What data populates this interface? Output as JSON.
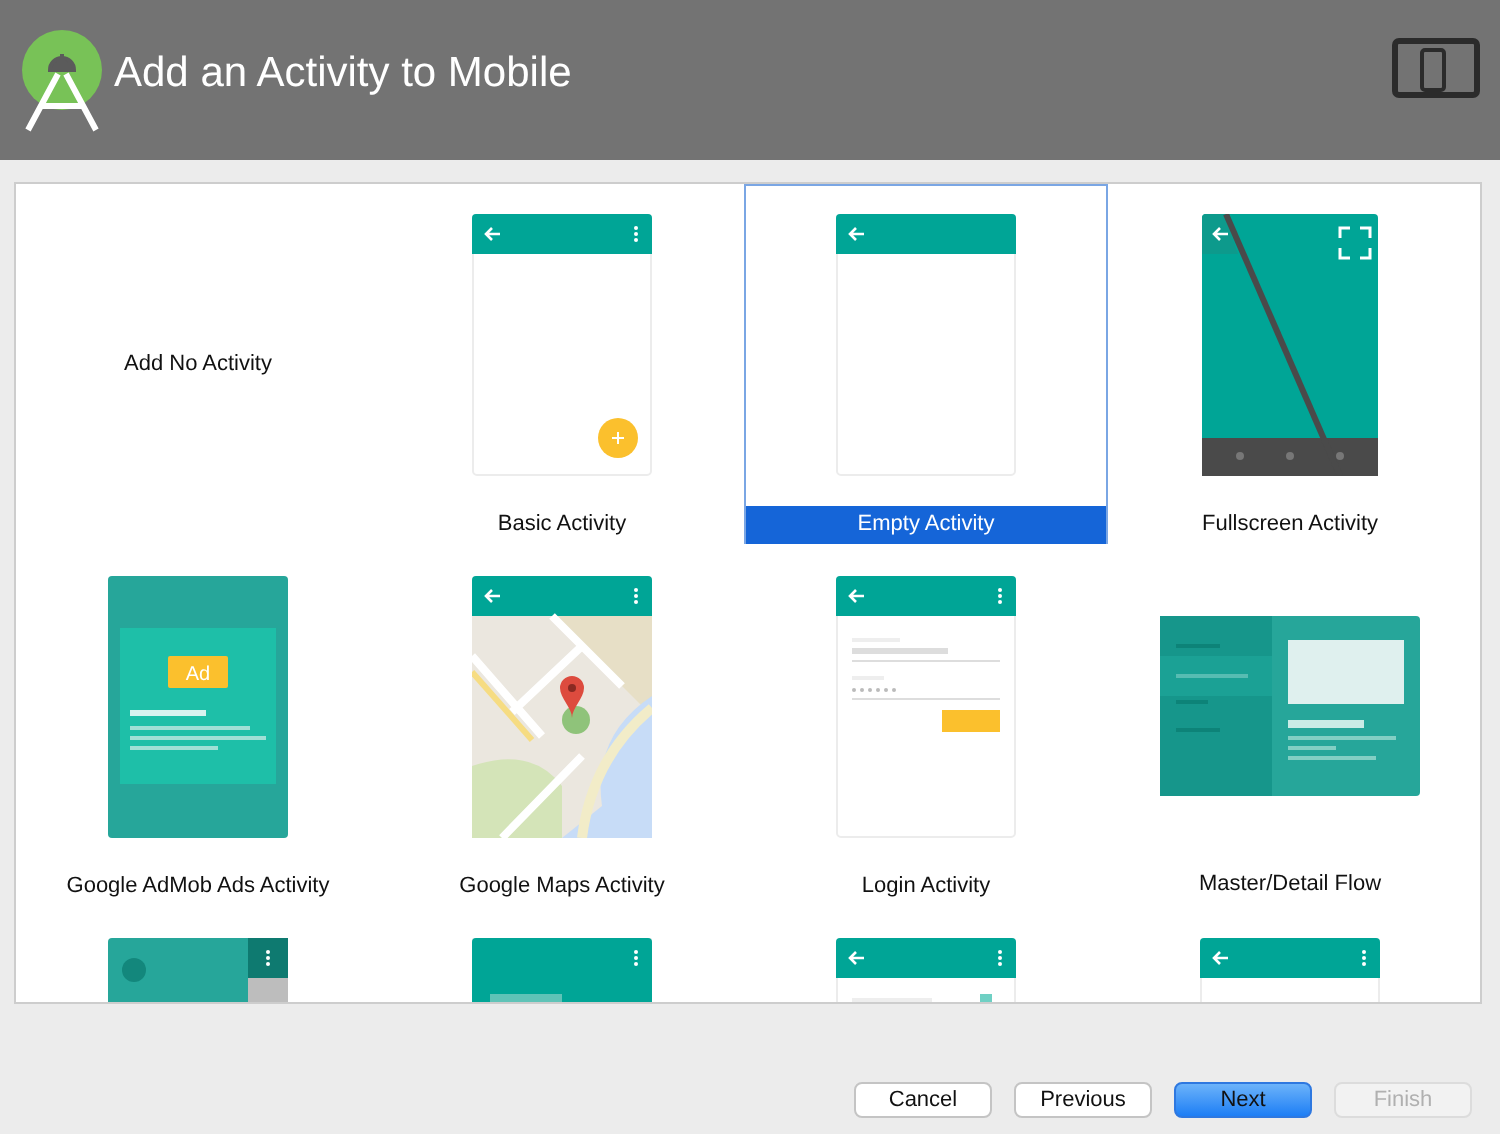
{
  "window": {
    "title": "Add an Activity to Mobile"
  },
  "tiles": [
    {
      "kind": "none",
      "label": "Add No Activity",
      "selected": false
    },
    {
      "kind": "basic",
      "label": "Basic Activity",
      "selected": false
    },
    {
      "kind": "empty",
      "label": "Empty Activity",
      "selected": true
    },
    {
      "kind": "fullscreen",
      "label": "Fullscreen Activity",
      "selected": false
    },
    {
      "kind": "ad",
      "badge": "Ad",
      "label": "Google AdMob Ads Activity",
      "selected": false
    },
    {
      "kind": "map",
      "label": "Google Maps Activity",
      "selected": false
    },
    {
      "kind": "login",
      "label": "Login Activity",
      "selected": false
    },
    {
      "kind": "master",
      "label": "Master/Detail Flow",
      "selected": false
    },
    {
      "kind": "drawer",
      "selected": false
    },
    {
      "kind": "scrolling",
      "selected": false
    },
    {
      "kind": "form",
      "selected": false
    },
    {
      "kind": "menu",
      "selected": false
    }
  ],
  "buttons": [
    {
      "label": "Cancel",
      "primary": false,
      "disabled": false
    },
    {
      "label": "Previous",
      "primary": false,
      "disabled": false
    },
    {
      "label": "Next",
      "primary": true,
      "disabled": false
    },
    {
      "label": "Finish",
      "primary": false,
      "disabled": true
    }
  ]
}
